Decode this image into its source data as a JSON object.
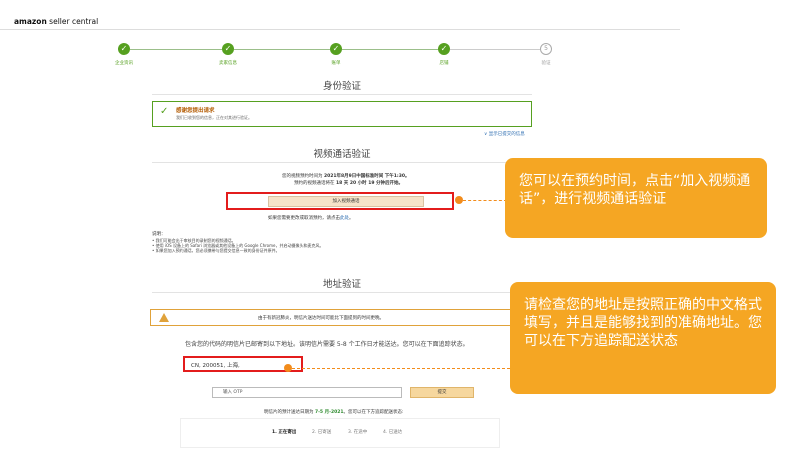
{
  "header": {
    "logo_bold": "amazon",
    "logo_light": " seller central"
  },
  "steps": [
    {
      "label": "企业资讯",
      "status": "done"
    },
    {
      "label": "卖家信息",
      "status": "done"
    },
    {
      "label": "账单",
      "status": "done"
    },
    {
      "label": "店铺",
      "status": "done"
    },
    {
      "label": "验证",
      "status": "pending",
      "number": "5"
    }
  ],
  "icons": {
    "step_done": "check-icon",
    "success": "check-icon",
    "warning": "warning-icon"
  },
  "identity": {
    "title": "身份验证",
    "success_title": "感谢您提出请求",
    "success_sub": "我们已收到您的信息，正在对其进行验证。",
    "show_link": "∨ 显示已提交的信息"
  },
  "video": {
    "title": "视频通话验证",
    "appt_line1_pre": "您的视频预约时间为 ",
    "appt_line1_bold": "2021年8月9日中国标准时间 下午1:30。",
    "appt_line2_pre": "预约的视频通话将在 ",
    "appt_line2_bold": "18 天 20 小时 19 分钟后开始。",
    "join_button": "加入视频通话",
    "reschedule_pre": "如果您需要更改或取消预约，请点击",
    "reschedule_link": "此处",
    "reschedule_post": "。",
    "notes_title": "说明：",
    "notes": [
      "我们可能会出于审核目的录制您的视频通话。",
      "使用 iOS 设备上的 Safari 浏览器或其他设备上的 Google Chrome，并启动摄像头和麦克风。",
      "如果您加入预约通话，您必须携带与您提交信息一致的身份证件原件。"
    ]
  },
  "address": {
    "title": "地址验证",
    "warning": "由于有新冠肺炎，明信片送达时间可能比下面提到的时间更晚。",
    "postcard_info": "包含您的代码的明信片已邮寄到以下地址。该明信片需要 5-8 个工作日才能送达。您可以在下面追踪状态。",
    "address_value": "CN, 200051, 上海,",
    "otp_placeholder": "输入 OTP",
    "submit": "提交",
    "arrive_pre": "明信片的预计送达日期为 ",
    "arrive_date": "7-5 月-2021",
    "arrive_post": "。您可以在下方追踪配送状态:",
    "tracking": [
      {
        "label": "1. 正在寄出",
        "active": true
      },
      {
        "label": "2. 已寄送",
        "active": false
      },
      {
        "label": "3. 在途中",
        "active": false
      },
      {
        "label": "4. 已送达",
        "active": false
      }
    ]
  },
  "callouts": {
    "video": "您可以在预约时间，点击“加入视频通话”，进行视频通话验证",
    "address": "请检查您的地址是按照正确的中文格式填写，并且是能够找到的准确地址。您可以在下方追踪配送状态"
  },
  "colors": {
    "accent_green": "#56a020",
    "callout_orange": "#f5a623",
    "highlight_red": "#e31c1c",
    "warning_orange": "#e0a23a"
  }
}
